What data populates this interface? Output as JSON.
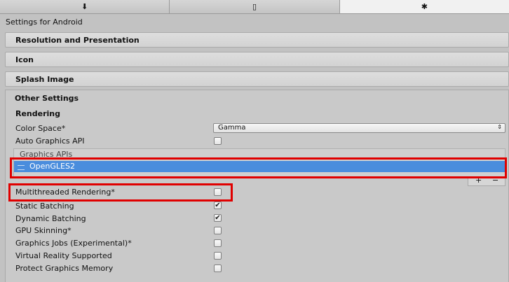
{
  "tabs": [
    {
      "name": "download-icon",
      "glyph": "⬇"
    },
    {
      "name": "mobile-icon",
      "glyph": "▯"
    },
    {
      "name": "android-icon",
      "glyph": "✱"
    }
  ],
  "title": "Settings for Android",
  "sections": {
    "resolution": "Resolution and Presentation",
    "icon": "Icon",
    "splash": "Splash Image",
    "other": "Other Settings"
  },
  "rendering": {
    "heading": "Rendering",
    "color_space_label": "Color Space*",
    "color_space_value": "Gamma",
    "auto_graphics_label": "Auto Graphics API",
    "graphics_apis_header": "Graphics APIs",
    "graphics_api_item": "OpenGLES2",
    "plus": "+",
    "minus": "−",
    "multithreaded_label": "Multithreaded Rendering*",
    "static_batching_label": "Static Batching",
    "dynamic_batching_label": "Dynamic Batching",
    "gpu_skinning_label": "GPU Skinning*",
    "graphics_jobs_label": "Graphics Jobs (Experimental)*",
    "vr_label": "Virtual Reality Supported",
    "protect_memory_label": "Protect Graphics Memory"
  },
  "checkboxes": {
    "auto_graphics": false,
    "multithreaded": false,
    "static_batching": true,
    "dynamic_batching": true,
    "gpu_skinning": false,
    "graphics_jobs": false,
    "vr": false,
    "protect_memory": false
  },
  "colors": {
    "highlight": "#e00000",
    "selection": "#4a8ddd"
  }
}
